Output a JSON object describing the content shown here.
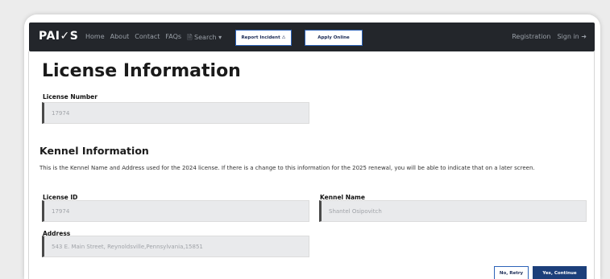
{
  "nav": {
    "brand": "PAI✓S",
    "links": [
      "Home",
      "About",
      "Contact",
      "FAQs",
      "🗎 Search ▾"
    ],
    "report_button": "Report Incident ⚠",
    "apply_button": "Apply Online",
    "registration": "Registration",
    "signin": "Sign in ➜"
  },
  "page": {
    "title": "License Information",
    "license_number_label": "License Number",
    "license_number_value": "17974"
  },
  "kennel": {
    "heading": "Kennel Information",
    "description": "This is the Kennel Name and Address used for the 2024 license. If there is a change to this information for the 2025 renewal, you will be able to indicate that on a later screen.",
    "license_id_label": "License ID",
    "license_id_value": "17974",
    "kennel_name_label": "Kennel Name",
    "kennel_name_value": "Shantel Osipovitch",
    "address_label": "Address",
    "address_value": "543 E. Main Street, Reynoldsville,Pennsylvania,15851"
  },
  "actions": {
    "no_label": "No, Retry",
    "yes_label": "Yes, Continue"
  },
  "colors": {
    "nav_bg": "#23262b",
    "primary": "#1c3f7a",
    "field_bg": "#e9eaec"
  }
}
